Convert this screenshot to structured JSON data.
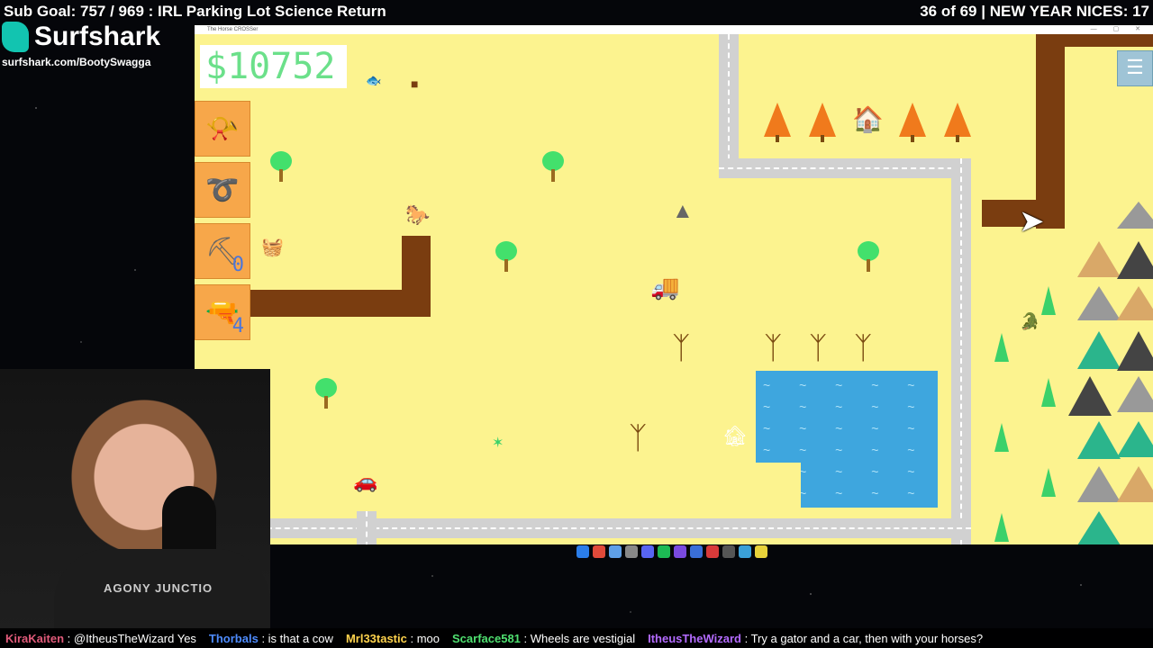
{
  "overlay": {
    "sub_goal": "Sub Goal: 757 / 969 : IRL Parking Lot Science Return",
    "counter": "36 of 69 | NEW YEAR NICES: 17"
  },
  "sponsor": {
    "brand": "Surfshark",
    "url": "surfshark.com/BootySwagga"
  },
  "game": {
    "window_title": "The Horse CROSSer",
    "money": "$10752",
    "tools": [
      {
        "name": "horn",
        "count": ""
      },
      {
        "name": "lasso",
        "count": ""
      },
      {
        "name": "shovel",
        "count": "0"
      },
      {
        "name": "gun",
        "count": "4"
      }
    ],
    "menu_icon": "hamburger-menu-icon"
  },
  "shirt_text": "AGONY JUNCTIO",
  "chat": [
    {
      "user": "KiraKaiten",
      "color": "#e05a7a",
      "message": "@ItheusTheWizard Yes"
    },
    {
      "user": "Thorbals",
      "color": "#4e8cff",
      "message": "is that a cow"
    },
    {
      "user": "Mrl33tastic",
      "color": "#ffd34d",
      "message": "moo"
    },
    {
      "user": "Scarface581",
      "color": "#4fe070",
      "message": "Wheels are vestigial"
    },
    {
      "user": "ItheusTheWizard",
      "color": "#b46bff",
      "message": "Try a gator and a car, then with your horses?"
    }
  ]
}
